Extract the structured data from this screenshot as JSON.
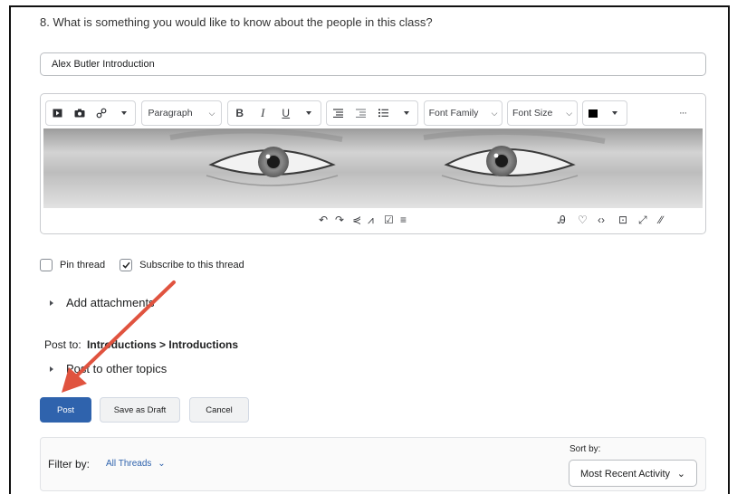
{
  "question": "8. What is something you would like to know about the people in this class?",
  "subject_input": {
    "value": "Alex Butler Introduction"
  },
  "toolbar": {
    "paragraph_label": "Paragraph",
    "bold": "B",
    "italic": "I",
    "underline": "U",
    "font_family_label": "Font Family",
    "font_size_label": "Font Size",
    "more": "···",
    "text_color": "#000000"
  },
  "options": {
    "pin_thread_label": "Pin thread",
    "pin_thread_checked": false,
    "subscribe_label": "Subscribe to this thread",
    "subscribe_checked": true
  },
  "add_attachments_label": "Add attachments",
  "post_to": {
    "prefix": "Post to:",
    "destination": "Introductions > Introductions"
  },
  "post_other_topics_label": "Post to other topics",
  "actions": {
    "post_label": "Post",
    "save_draft_label": "Save as Draft",
    "cancel_label": "Cancel"
  },
  "filter": {
    "label": "Filter by:",
    "value": "All Threads",
    "sort_label": "Sort by:",
    "sort_value": "Most Recent Activity"
  },
  "colors": {
    "primary_button": "#2f63ad",
    "annotation_arrow": "#e0533f",
    "link_blue": "#2f63ad"
  }
}
